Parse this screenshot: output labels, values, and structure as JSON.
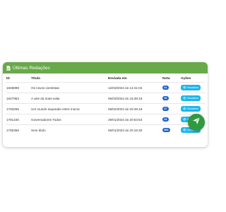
{
  "card": {
    "title": "Últimas Redações",
    "icon": "document-icon",
    "accent": "#68a94a"
  },
  "table": {
    "headers": {
      "id": "ID",
      "title": "Título",
      "sent_at": "Enviada em",
      "grade": "Nota",
      "actions": "Ações"
    },
    "rows": [
      {
        "id": "1836898",
        "title": "Os novos cientistas",
        "sent_at": "12/03/2024 às 14:41:02",
        "grade": "41",
        "action": "Visualizar"
      },
      {
        "id": "1827953",
        "title": "A arte da mais-valia",
        "sent_at": "06/03/2024 às 16:38:18",
        "grade": "15",
        "action": "Visualizar"
      },
      {
        "id": "1793265",
        "title": "Um mundo separado entre muros",
        "sent_at": "06/02/2024 às 20:48:19",
        "grade": "37",
        "action": "Visualizar"
      },
      {
        "id": "1781230",
        "title": "Governadores Todos",
        "sent_at": "29/01/2024 às 20:53:53",
        "grade": "23",
        "action": "Visualizar"
      },
      {
        "id": "1755356",
        "title": "Sem título",
        "sent_at": "06/01/2024 às 20:15:30",
        "grade": "600",
        "action": "Visualizar"
      }
    ]
  },
  "fab": {
    "icon": "send-icon",
    "color": "#2f9a3f"
  }
}
